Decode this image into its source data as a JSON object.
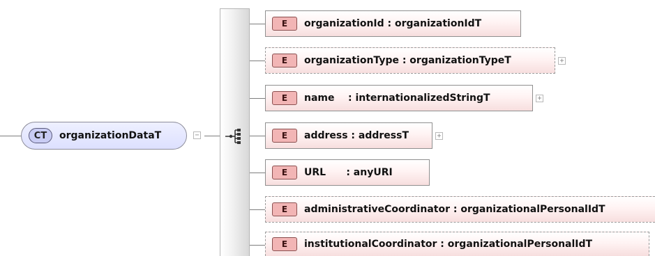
{
  "complex_type": {
    "badge": "CT",
    "name": "organizationDataT",
    "toggle": "−"
  },
  "sequence": {
    "icon": "sequence-compositor-icon"
  },
  "elements": [
    {
      "badge": "E",
      "label": "organizationId : organizationIdT",
      "optional": false,
      "expandable": false
    },
    {
      "badge": "E",
      "label": "organizationType : organizationTypeT",
      "optional": true,
      "expandable": true
    },
    {
      "badge": "E",
      "label": "name    : internationalizedStringT",
      "optional": false,
      "expandable": true
    },
    {
      "badge": "E",
      "label": "address : addressT",
      "optional": false,
      "expandable": true
    },
    {
      "badge": "E",
      "label": "URL      : anyURI",
      "optional": false,
      "expandable": false
    },
    {
      "badge": "E",
      "label": "administrativeCoordinator : organizationalPersonalIdT",
      "optional": true,
      "expandable": false
    },
    {
      "badge": "E",
      "label": "institutionalCoordinator : organizationalPersonalIdT",
      "optional": true,
      "expandable": false
    }
  ],
  "expand_symbol": "+",
  "colors": {
    "element_badge": "#f2b5b5",
    "element_fill": "#f7dede",
    "complex_type_fill": "#dde0ff",
    "connector": "#7d7d7d"
  }
}
